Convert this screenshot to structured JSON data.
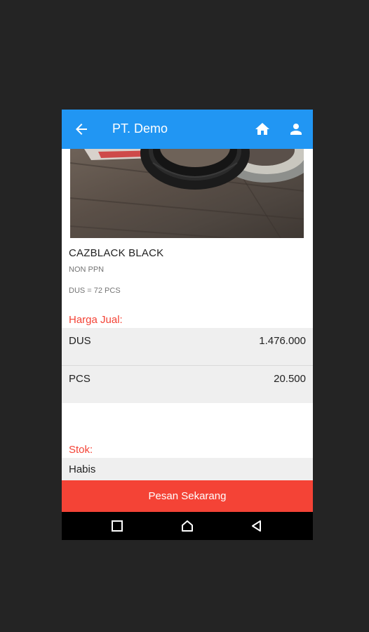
{
  "app_bar": {
    "title": "PT. Demo",
    "color": "#2196f3",
    "icons": [
      "arrow-back-icon",
      "home-icon",
      "account-icon"
    ]
  },
  "product": {
    "name": "CAZBLACK BLACK",
    "tax_status": "NON PPN",
    "unit_conversion": "DUS = 72 PCS",
    "image": "product-photo"
  },
  "price_section": {
    "label": "Harga Jual:",
    "rows": [
      {
        "unit": "DUS",
        "price": "1.476.000"
      },
      {
        "unit": "PCS",
        "price": "20.500"
      }
    ]
  },
  "stock_section": {
    "label": "Stok:",
    "value": "Habis"
  },
  "order_button": {
    "label": "Pesan Sekarang",
    "color": "#f44336"
  },
  "nav_bar": {
    "icons": [
      "recents-icon",
      "home-nav-icon",
      "back-nav-icon"
    ]
  }
}
